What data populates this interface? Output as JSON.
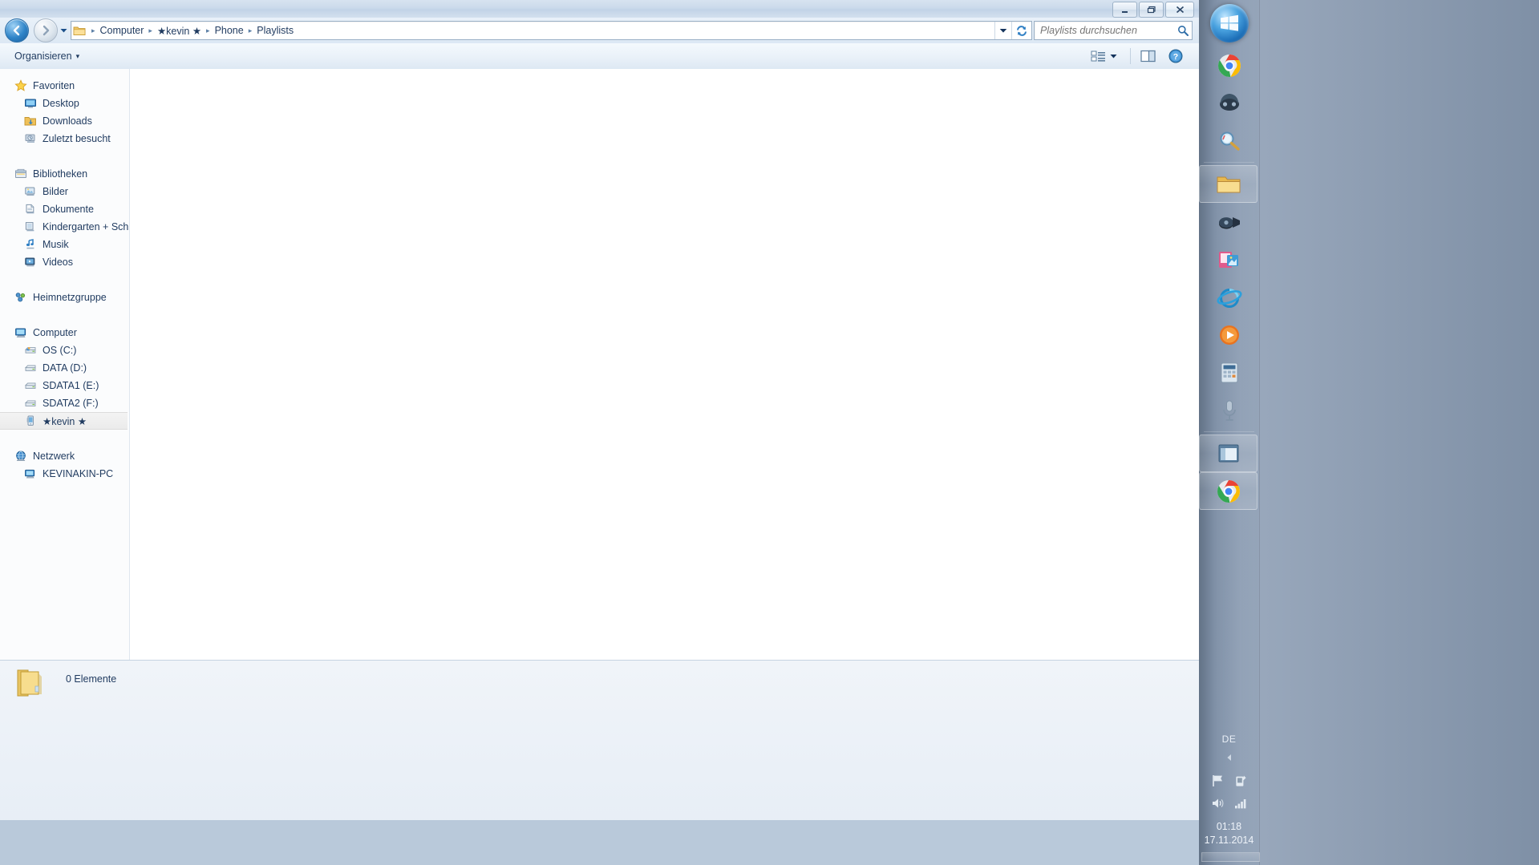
{
  "window": {
    "minimize_label": "Minimieren",
    "maximize_label": "Maximieren",
    "close_label": "Schließen"
  },
  "address_bar": {
    "back_label": "Zurück",
    "forward_label": "Vorwärts",
    "history_label": "Letzte Seiten",
    "breadcrumbs": [
      {
        "label": "Computer"
      },
      {
        "label": "★kevin ★"
      },
      {
        "label": "Phone"
      },
      {
        "label": "Playlists"
      }
    ],
    "separator": "▸",
    "dropdown_label": "Vorherige Orte",
    "refresh_label": "Aktualisieren"
  },
  "search": {
    "placeholder": "Playlists durchsuchen",
    "value": "",
    "icon": "search-icon"
  },
  "toolbar": {
    "organize_label": "Organisieren",
    "organize_caret": "▾",
    "view_label": "Ansicht ändern",
    "view_caret": "▾",
    "preview_label": "Vorschaufenster",
    "help_label": "Hilfe",
    "help_glyph": "?"
  },
  "sidebar": {
    "groups": [
      {
        "header": {
          "label": "Favoriten",
          "icon": "star-icon"
        },
        "items": [
          {
            "label": "Desktop",
            "icon": "desktop-icon"
          },
          {
            "label": "Downloads",
            "icon": "downloads-folder-icon"
          },
          {
            "label": "Zuletzt besucht",
            "icon": "recent-places-icon"
          }
        ]
      },
      {
        "header": {
          "label": "Bibliotheken",
          "icon": "libraries-icon"
        },
        "items": [
          {
            "label": "Bilder",
            "icon": "pictures-library-icon"
          },
          {
            "label": "Dokumente",
            "icon": "documents-library-icon"
          },
          {
            "label": "Kindergarten + Schul",
            "icon": "library-icon"
          },
          {
            "label": "Musik",
            "icon": "music-library-icon"
          },
          {
            "label": "Videos",
            "icon": "videos-library-icon"
          }
        ]
      },
      {
        "header": {
          "label": "Heimnetzgruppe",
          "icon": "homegroup-icon"
        },
        "items": []
      },
      {
        "header": {
          "label": "Computer",
          "icon": "computer-icon"
        },
        "items": [
          {
            "label": "OS (C:)",
            "icon": "system-drive-icon"
          },
          {
            "label": "DATA (D:)",
            "icon": "drive-icon"
          },
          {
            "label": "SDATA1 (E:)",
            "icon": "drive-icon"
          },
          {
            "label": "SDATA2 (F:)",
            "icon": "drive-icon"
          },
          {
            "label": "★kevin ★",
            "icon": "portable-device-icon",
            "selected": true
          }
        ]
      },
      {
        "header": {
          "label": "Netzwerk",
          "icon": "network-icon"
        },
        "items": [
          {
            "label": "KEVINAKIN-PC",
            "icon": "network-computer-icon"
          }
        ]
      }
    ]
  },
  "file_list": {
    "items": [],
    "empty": true
  },
  "status_bar": {
    "icon": "folder-icon",
    "item_count_label": "0 Elemente"
  },
  "taskbar": {
    "start_label": "Start",
    "buttons": [
      {
        "name": "chrome",
        "label": "Google Chrome"
      },
      {
        "name": "jdownloader",
        "label": "JDownloader"
      },
      {
        "name": "everything-search",
        "label": "Everything"
      },
      {
        "name": "explorer",
        "label": "Windows-Explorer",
        "running": true
      },
      {
        "name": "media-player-classic",
        "label": "Media Player Classic"
      },
      {
        "name": "photo-tool",
        "label": "Fotoanzeige"
      },
      {
        "name": "internet-explorer",
        "label": "Internet Explorer"
      },
      {
        "name": "media-player",
        "label": "Windows Media Player"
      },
      {
        "name": "calculator",
        "label": "Rechner"
      },
      {
        "name": "recorder",
        "label": "Aufnahme"
      },
      {
        "name": "explorer-window",
        "label": "Explorer-Fenster",
        "running": true
      },
      {
        "name": "chrome-window",
        "label": "Chrome-Fenster",
        "running": true
      }
    ],
    "tray": {
      "language": "DE",
      "expand_glyph": "◀",
      "action_center_label": "Wartungscenter",
      "removable_media_label": "Hardware sicher entfernen",
      "volume_label": "Lautstärke",
      "network_label": "Netzwerk",
      "time": "01:18",
      "date": "17.11.2014",
      "show_desktop_label": "Desktop anzeigen"
    }
  }
}
